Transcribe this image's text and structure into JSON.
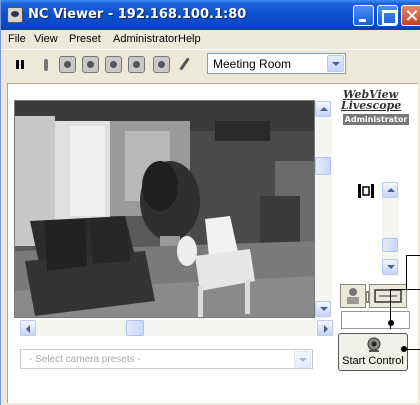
{
  "window": {
    "title": "NC Viewer - 192.168.100.1:80"
  },
  "menu": {
    "items": [
      "File",
      "View",
      "Preset",
      "Administrator",
      "Help"
    ]
  },
  "toolbar": {
    "icons": [
      "pause-icon",
      "signal-icon",
      "snapshot-icon",
      "settings-icon",
      "record-icon",
      "network-icon",
      "audio-icon",
      "microphone-icon"
    ],
    "preset_select": "Meeting Room"
  },
  "viewer": {
    "camera_presets_placeholder": "- Select camera presets -"
  },
  "logo": {
    "line1": "WebView",
    "line2": "Livescope",
    "badge": "Administrator"
  },
  "controls": {
    "start_control_label": "Start Control"
  },
  "colors": {
    "titlebar": "#0a4fd0",
    "window_bg": "#ece9d8",
    "callout": "#000000"
  }
}
